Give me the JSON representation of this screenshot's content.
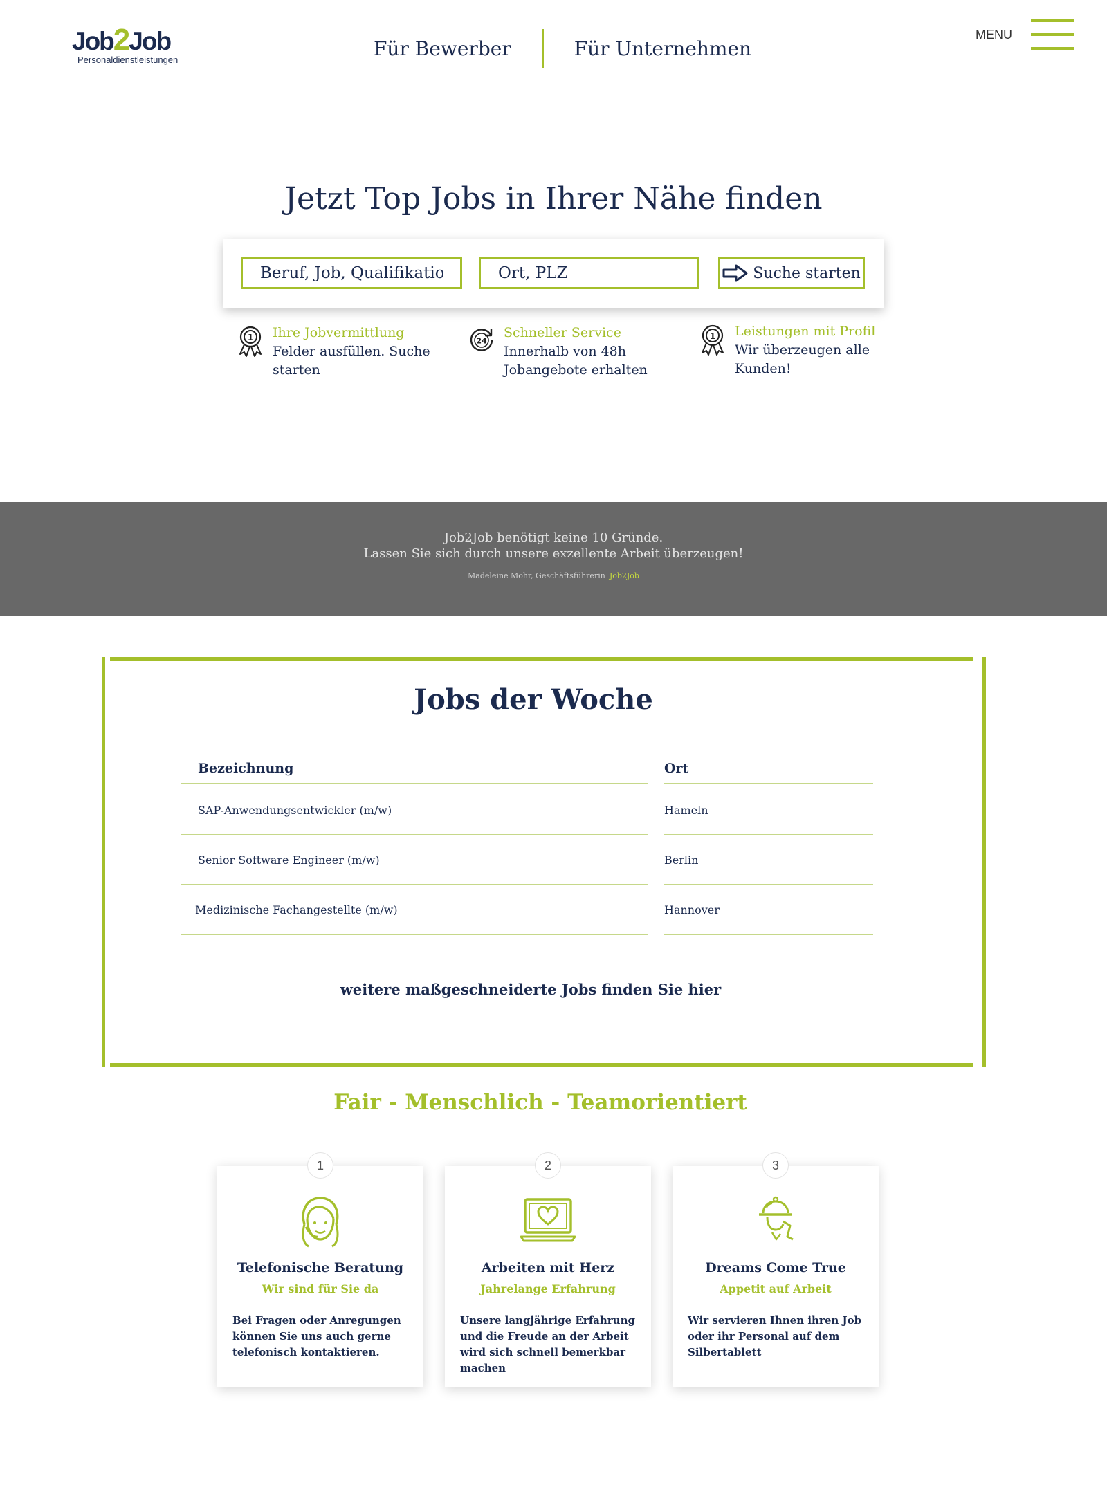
{
  "brand": {
    "logo_main": "Job",
    "logo_two": "2",
    "logo_end": "Job",
    "logo_sub": "Personaldienstleistungen",
    "accent": "#a4bf2b",
    "navy": "#1b2a4e"
  },
  "nav": {
    "applicants": "Für Bewerber",
    "companies": "Für Unternehmen",
    "menu_label": "MENU",
    "menu_icon": "hamburger-icon"
  },
  "hero": {
    "title": "Jetzt Top Jobs in Ihrer Nähe finden",
    "search": {
      "job_placeholder": "Beruf, Job, Qualifikation",
      "location_placeholder": "Ort, PLZ",
      "button_label": "Suche starten",
      "button_icon": "arrow-right-icon"
    },
    "features": [
      {
        "icon": "award-icon",
        "title": "Ihre Jobvermittlung",
        "text": "Felder ausfüllen. Suche starten"
      },
      {
        "icon": "24h-icon",
        "title": "Schneller Service",
        "text": "Innerhalb von 48h Jobangebote erhalten"
      },
      {
        "icon": "award-icon",
        "title": "Leistungen mit Profil",
        "text": "Wir überzeugen alle Kunden!"
      }
    ]
  },
  "quote": {
    "line1": "Job2Job benötigt keine 10 Gründe.",
    "line2": "Lassen Sie sich durch unsere exzellente Arbeit überzeugen!",
    "author": "Madeleine Mohr, Geschäftsführerin",
    "company": "Job2Job"
  },
  "jobs": {
    "title": "Jobs der Woche",
    "col_title": "Bezeichnung",
    "col_location": "Ort",
    "rows": [
      {
        "title": "SAP-Anwendungsentwickler (m/w)",
        "location": "Hameln"
      },
      {
        "title": "Senior Software Engineer (m/w)",
        "location": "Berlin"
      },
      {
        "title": "Medizinische Fachangestellte (m/w)",
        "location": "Hannover"
      }
    ],
    "more_link": "weitere maßgeschneiderte Jobs finden Sie hier"
  },
  "tagline": "Fair - Menschlich - Teamorientiert",
  "cards": [
    {
      "num": "1",
      "icon": "headset-woman-icon",
      "title": "Telefonische Beratung",
      "subtitle": "Wir sind für Sie da",
      "text": "Bei Fragen oder Anregungen können Sie uns auch gerne telefonisch kontaktieren."
    },
    {
      "num": "2",
      "icon": "laptop-heart-icon",
      "title": "Arbeiten mit Herz",
      "subtitle": "Jahrelange Erfahrung",
      "text": "Unsere langjährige Erfahrung und die Freude an der Arbeit wird sich schnell bemerkbar machen"
    },
    {
      "num": "3",
      "icon": "waiter-cloche-icon",
      "title": "Dreams Come True",
      "subtitle": "Appetit auf Arbeit",
      "text": "Wir servieren Ihnen ihren Job oder ihr Personal auf dem Silbertablett"
    }
  ]
}
